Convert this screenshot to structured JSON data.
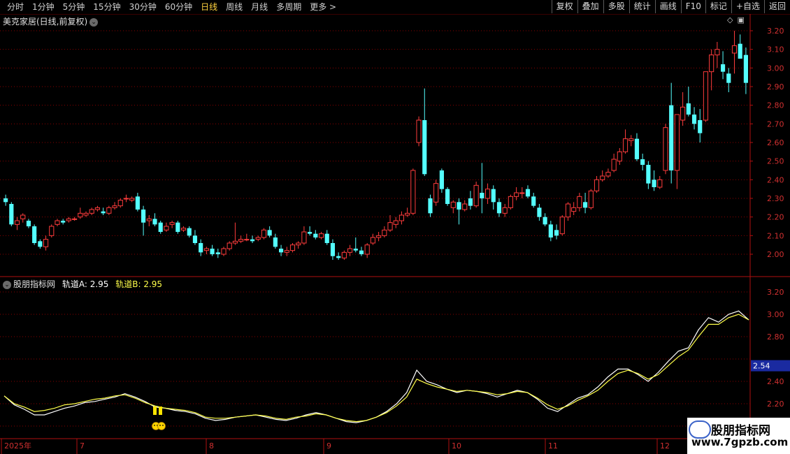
{
  "toolbar": {
    "periods": [
      {
        "label": "分时",
        "active": false
      },
      {
        "label": "1分钟",
        "active": false
      },
      {
        "label": "5分钟",
        "active": false
      },
      {
        "label": "15分钟",
        "active": false
      },
      {
        "label": "30分钟",
        "active": false
      },
      {
        "label": "60分钟",
        "active": false
      },
      {
        "label": "日线",
        "active": true
      },
      {
        "label": "周线",
        "active": false
      },
      {
        "label": "月线",
        "active": false
      },
      {
        "label": "多周期",
        "active": false
      },
      {
        "label": "更多 >",
        "active": false
      }
    ],
    "actions": [
      "复权",
      "叠加",
      "多股",
      "统计",
      "画线",
      "F10",
      "标记",
      "+自选",
      "返回"
    ]
  },
  "main_chart": {
    "title": "美克家居(日线,前复权)",
    "y_ticks": [
      "3.20",
      "3.10",
      "3.00",
      "2.90",
      "2.80",
      "2.70",
      "2.60",
      "2.50",
      "2.40",
      "2.30",
      "2.20",
      "2.10",
      "2.00"
    ],
    "colors": {
      "up": "#ff3c3c",
      "down": "#54ffff",
      "grid": "#8a0000",
      "axis": "#c02020"
    }
  },
  "indicator": {
    "name": "股朋指标网",
    "line_a_label": "轨道A",
    "line_a_value": "2.95",
    "line_b_label": "轨道B",
    "line_b_value": "2.95",
    "y_ticks": [
      "3.20",
      "3.00",
      "2.80",
      "2.40",
      "2.20"
    ],
    "current_marker": "2.54",
    "signal_icon": "smiley-icon"
  },
  "x_axis": {
    "labels": [
      "2025年",
      "7",
      "8",
      "9",
      "10",
      "11",
      "12"
    ]
  },
  "watermark": {
    "line1": "股朋指标网",
    "line2": "www.7gpzb.com"
  },
  "chart_data": [
    {
      "type": "candlestick",
      "title": "美克家居(日线,前复权)",
      "ylim": [
        1.93,
        3.25
      ],
      "categories_start": "2025年",
      "month_labels": [
        "7",
        "8",
        "9",
        "10",
        "11",
        "12"
      ],
      "ohlc": [
        [
          2.3,
          2.32,
          2.26,
          2.28
        ],
        [
          2.27,
          2.28,
          2.15,
          2.16
        ],
        [
          2.16,
          2.2,
          2.13,
          2.18
        ],
        [
          2.19,
          2.22,
          2.17,
          2.21
        ],
        [
          2.18,
          2.19,
          2.14,
          2.15
        ],
        [
          2.15,
          2.16,
          2.05,
          2.06
        ],
        [
          2.07,
          2.08,
          2.03,
          2.04
        ],
        [
          2.04,
          2.1,
          2.02,
          2.08
        ],
        [
          2.1,
          2.16,
          2.09,
          2.15
        ],
        [
          2.16,
          2.19,
          2.15,
          2.18
        ],
        [
          2.18,
          2.19,
          2.16,
          2.17
        ],
        [
          2.18,
          2.2,
          2.17,
          2.19
        ],
        [
          2.19,
          2.2,
          2.18,
          2.19
        ],
        [
          2.2,
          2.25,
          2.19,
          2.22
        ],
        [
          2.21,
          2.23,
          2.2,
          2.22
        ],
        [
          2.22,
          2.25,
          2.21,
          2.24
        ],
        [
          2.24,
          2.26,
          2.23,
          2.25
        ],
        [
          2.23,
          2.25,
          2.21,
          2.22
        ],
        [
          2.22,
          2.26,
          2.21,
          2.25
        ],
        [
          2.25,
          2.28,
          2.24,
          2.26
        ],
        [
          2.26,
          2.3,
          2.25,
          2.29
        ],
        [
          2.3,
          2.32,
          2.28,
          2.3
        ],
        [
          2.29,
          2.31,
          2.28,
          2.3
        ],
        [
          2.31,
          2.33,
          2.23,
          2.24
        ],
        [
          2.24,
          2.26,
          2.1,
          2.17
        ],
        [
          2.18,
          2.21,
          2.15,
          2.19
        ],
        [
          2.19,
          2.22,
          2.15,
          2.16
        ],
        [
          2.17,
          2.18,
          2.11,
          2.12
        ],
        [
          2.13,
          2.17,
          2.12,
          2.15
        ],
        [
          2.16,
          2.18,
          2.14,
          2.17
        ],
        [
          2.17,
          2.18,
          2.11,
          2.12
        ],
        [
          2.13,
          2.15,
          2.12,
          2.14
        ],
        [
          2.14,
          2.15,
          2.09,
          2.1
        ],
        [
          2.1,
          2.13,
          2.05,
          2.06
        ],
        [
          2.06,
          2.08,
          1.99,
          2.01
        ],
        [
          2.02,
          2.04,
          2.0,
          2.03
        ],
        [
          2.03,
          2.05,
          1.99,
          2.0
        ],
        [
          2.01,
          2.03,
          1.98,
          2.0
        ],
        [
          2.0,
          2.04,
          1.99,
          2.03
        ],
        [
          2.03,
          2.07,
          2.02,
          2.06
        ],
        [
          2.06,
          2.17,
          2.05,
          2.07
        ],
        [
          2.07,
          2.1,
          2.06,
          2.08
        ],
        [
          2.08,
          2.11,
          2.07,
          2.08
        ],
        [
          2.08,
          2.1,
          2.06,
          2.07
        ],
        [
          2.08,
          2.1,
          2.07,
          2.09
        ],
        [
          2.09,
          2.14,
          2.08,
          2.13
        ],
        [
          2.13,
          2.15,
          2.09,
          2.1
        ],
        [
          2.09,
          2.11,
          2.03,
          2.04
        ],
        [
          2.03,
          2.05,
          1.99,
          2.01
        ],
        [
          2.01,
          2.04,
          1.99,
          2.02
        ],
        [
          2.02,
          2.06,
          2.01,
          2.05
        ],
        [
          2.05,
          2.07,
          2.03,
          2.06
        ],
        [
          2.06,
          2.15,
          2.05,
          2.12
        ],
        [
          2.12,
          2.15,
          2.1,
          2.11
        ],
        [
          2.11,
          2.13,
          2.08,
          2.09
        ],
        [
          2.09,
          2.12,
          2.08,
          2.11
        ],
        [
          2.11,
          2.13,
          2.05,
          2.06
        ],
        [
          2.06,
          2.08,
          1.97,
          1.99
        ],
        [
          1.99,
          2.01,
          1.97,
          1.98
        ],
        [
          1.98,
          2.02,
          1.97,
          2.01
        ],
        [
          2.01,
          2.05,
          1.99,
          2.03
        ],
        [
          2.03,
          2.09,
          2.01,
          2.02
        ],
        [
          2.02,
          2.04,
          1.99,
          2.0
        ],
        [
          2.0,
          2.06,
          1.98,
          2.05
        ],
        [
          2.06,
          2.11,
          2.05,
          2.09
        ],
        [
          2.09,
          2.12,
          2.07,
          2.1
        ],
        [
          2.1,
          2.15,
          2.09,
          2.13
        ],
        [
          2.13,
          2.21,
          2.12,
          2.17
        ],
        [
          2.16,
          2.2,
          2.14,
          2.18
        ],
        [
          2.18,
          2.23,
          2.16,
          2.21
        ],
        [
          2.21,
          2.25,
          2.2,
          2.22
        ],
        [
          2.22,
          2.46,
          2.21,
          2.45
        ],
        [
          2.6,
          2.74,
          2.58,
          2.72
        ],
        [
          2.72,
          2.89,
          2.42,
          2.43
        ],
        [
          2.3,
          2.32,
          2.2,
          2.22
        ],
        [
          2.28,
          2.4,
          2.26,
          2.38
        ],
        [
          2.45,
          2.46,
          2.33,
          2.35
        ],
        [
          2.35,
          2.36,
          2.26,
          2.27
        ],
        [
          2.25,
          2.29,
          2.22,
          2.28
        ],
        [
          2.28,
          2.3,
          2.16,
          2.24
        ],
        [
          2.24,
          2.29,
          2.23,
          2.27
        ],
        [
          2.3,
          2.34,
          2.24,
          2.26
        ],
        [
          2.26,
          2.39,
          2.25,
          2.37
        ],
        [
          2.33,
          2.49,
          2.22,
          2.3
        ],
        [
          2.3,
          2.38,
          2.27,
          2.35
        ],
        [
          2.35,
          2.37,
          2.24,
          2.28
        ],
        [
          2.28,
          2.3,
          2.2,
          2.22
        ],
        [
          2.22,
          2.27,
          2.2,
          2.25
        ],
        [
          2.25,
          2.32,
          2.24,
          2.31
        ],
        [
          2.31,
          2.36,
          2.29,
          2.33
        ],
        [
          2.33,
          2.36,
          2.3,
          2.33
        ],
        [
          2.35,
          2.37,
          2.3,
          2.31
        ],
        [
          2.31,
          2.33,
          2.25,
          2.26
        ],
        [
          2.25,
          2.27,
          2.18,
          2.2
        ],
        [
          2.2,
          2.22,
          2.15,
          2.16
        ],
        [
          2.16,
          2.18,
          2.07,
          2.09
        ],
        [
          2.13,
          2.16,
          2.08,
          2.1
        ],
        [
          2.11,
          2.21,
          2.1,
          2.2
        ],
        [
          2.2,
          2.28,
          2.18,
          2.27
        ],
        [
          2.23,
          2.28,
          2.21,
          2.25
        ],
        [
          2.25,
          2.33,
          2.23,
          2.31
        ],
        [
          2.28,
          2.33,
          2.22,
          2.25
        ],
        [
          2.25,
          2.35,
          2.24,
          2.34
        ],
        [
          2.34,
          2.42,
          2.33,
          2.4
        ],
        [
          2.4,
          2.45,
          2.39,
          2.42
        ],
        [
          2.42,
          2.46,
          2.41,
          2.44
        ],
        [
          2.45,
          2.54,
          2.44,
          2.51
        ],
        [
          2.5,
          2.57,
          2.48,
          2.55
        ],
        [
          2.55,
          2.67,
          2.54,
          2.62
        ],
        [
          2.61,
          2.64,
          2.58,
          2.62
        ],
        [
          2.62,
          2.65,
          2.5,
          2.51
        ],
        [
          2.51,
          2.54,
          2.45,
          2.48
        ],
        [
          2.48,
          2.5,
          2.35,
          2.38
        ],
        [
          2.4,
          2.45,
          2.34,
          2.36
        ],
        [
          2.36,
          2.42,
          2.35,
          2.4
        ],
        [
          2.45,
          2.7,
          2.43,
          2.68
        ],
        [
          2.8,
          2.92,
          2.38,
          2.45
        ],
        [
          2.45,
          2.74,
          2.35,
          2.75
        ],
        [
          2.72,
          2.87,
          2.69,
          2.79
        ],
        [
          2.81,
          2.9,
          2.74,
          2.75
        ],
        [
          2.75,
          2.79,
          2.67,
          2.7
        ],
        [
          2.72,
          2.78,
          2.6,
          2.65
        ],
        [
          2.72,
          2.92,
          2.71,
          2.98
        ],
        [
          2.98,
          3.1,
          2.88,
          3.07
        ],
        [
          3.07,
          3.14,
          3.0,
          3.1
        ],
        [
          3.02,
          3.09,
          2.94,
          2.98
        ],
        [
          2.97,
          3.0,
          2.87,
          2.92
        ],
        [
          3.08,
          3.2,
          2.97,
          3.12
        ],
        [
          3.13,
          3.18,
          3.05,
          3.05
        ],
        [
          3.07,
          3.11,
          2.86,
          2.92
        ]
      ]
    },
    {
      "type": "line",
      "title": "股朋指标网",
      "ylim": [
        2.05,
        3.28
      ],
      "series": [
        {
          "name": "轨道A",
          "color": "#ffffff",
          "values": [
            2.27,
            2.19,
            2.15,
            2.1,
            2.1,
            2.13,
            2.16,
            2.18,
            2.21,
            2.22,
            2.24,
            2.26,
            2.29,
            2.26,
            2.22,
            2.17,
            2.16,
            2.14,
            2.13,
            2.11,
            2.07,
            2.05,
            2.06,
            2.08,
            2.09,
            2.1,
            2.08,
            2.06,
            2.05,
            2.07,
            2.1,
            2.12,
            2.1,
            2.07,
            2.04,
            2.03,
            2.05,
            2.08,
            2.13,
            2.2,
            2.3,
            2.5,
            2.4,
            2.37,
            2.33,
            2.3,
            2.32,
            2.31,
            2.29,
            2.26,
            2.29,
            2.32,
            2.3,
            2.24,
            2.16,
            2.13,
            2.19,
            2.25,
            2.28,
            2.35,
            2.44,
            2.51,
            2.51,
            2.46,
            2.4,
            2.48,
            2.58,
            2.67,
            2.7,
            2.86,
            2.97,
            2.93,
            3.0,
            3.03,
            2.95
          ]
        },
        {
          "name": "轨道B",
          "color": "#ffff4a",
          "values": [
            2.27,
            2.2,
            2.17,
            2.13,
            2.14,
            2.16,
            2.19,
            2.2,
            2.22,
            2.24,
            2.25,
            2.27,
            2.28,
            2.25,
            2.21,
            2.18,
            2.16,
            2.15,
            2.14,
            2.12,
            2.08,
            2.07,
            2.07,
            2.08,
            2.09,
            2.1,
            2.09,
            2.07,
            2.06,
            2.08,
            2.09,
            2.11,
            2.1,
            2.07,
            2.05,
            2.04,
            2.05,
            2.08,
            2.12,
            2.18,
            2.26,
            2.42,
            2.38,
            2.35,
            2.33,
            2.31,
            2.32,
            2.31,
            2.3,
            2.28,
            2.29,
            2.31,
            2.3,
            2.25,
            2.19,
            2.15,
            2.18,
            2.23,
            2.27,
            2.32,
            2.4,
            2.47,
            2.5,
            2.47,
            2.42,
            2.46,
            2.54,
            2.62,
            2.68,
            2.8,
            2.91,
            2.91,
            2.97,
            3.0,
            2.95
          ]
        }
      ]
    }
  ]
}
